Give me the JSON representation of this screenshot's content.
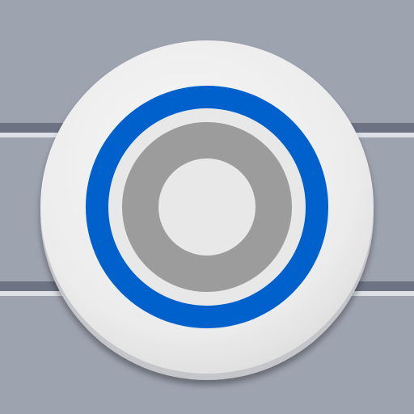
{
  "icon": {
    "name": "target-button-icon",
    "colors": {
      "background": "#9ea3b0",
      "stripe_dark": "#6d7383",
      "stripe_light": "#dde1e7",
      "button_face": "#eeeeee",
      "button_rim_shadow": "#c4c6ca",
      "outer_ring": "#0061cc",
      "inner_ring": "#9c9c9c",
      "center_dot": "#e8e8e8"
    }
  }
}
